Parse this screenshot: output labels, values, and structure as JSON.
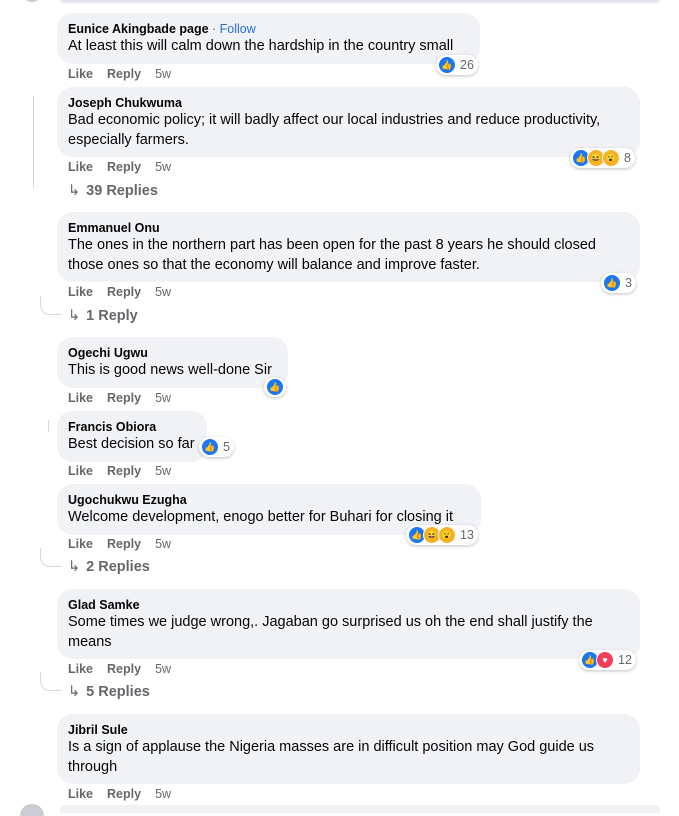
{
  "comments": [
    {
      "author": "Eunice Akingbade page",
      "follow": "Follow",
      "text": "At least this will calm down the hardship in the country small",
      "actions": {
        "like": "Like",
        "reply": "Reply",
        "time": "5w"
      },
      "reactions": {
        "types": [
          "like"
        ],
        "count": "26"
      }
    },
    {
      "author": "Joseph Chukwuma",
      "text": "Bad economic policy; it will badly affect our local industries and reduce productivity, especially farmers.",
      "actions": {
        "like": "Like",
        "reply": "Reply",
        "time": "5w"
      },
      "reactions": {
        "types": [
          "like",
          "haha",
          "wow"
        ],
        "count": "8"
      },
      "replies": "39 Replies"
    },
    {
      "author": "Emmanuel Onu",
      "text": "The ones in the northern part has been open for the past 8 years he should closed those ones so that the economy will balance and improve faster.",
      "actions": {
        "like": "Like",
        "reply": "Reply",
        "time": "5w"
      },
      "reactions": {
        "types": [
          "like"
        ],
        "count": "3"
      },
      "replies": "1 Reply"
    },
    {
      "author": "Ogechi Ugwu",
      "text": "This is good news well-done Sir",
      "actions": {
        "like": "Like",
        "reply": "Reply",
        "time": "5w"
      },
      "reactions": {
        "types": [
          "like"
        ],
        "count": ""
      }
    },
    {
      "author": "Francis Obiora",
      "text": "Best decision so far",
      "actions": {
        "like": "Like",
        "reply": "Reply",
        "time": "5w"
      },
      "reactions": {
        "types": [
          "like"
        ],
        "count": "5"
      }
    },
    {
      "author": "Ugochukwu Ezugha",
      "text": "Welcome development, enogo better for Buhari for closing it",
      "actions": {
        "like": "Like",
        "reply": "Reply",
        "time": "5w"
      },
      "reactions": {
        "types": [
          "like",
          "haha",
          "wow"
        ],
        "count": "13"
      },
      "replies": "2 Replies"
    },
    {
      "author": "Glad Samke",
      "text": "Some times we judge wrong,. Jagaban go surprised us oh the end shall justify the means",
      "actions": {
        "like": "Like",
        "reply": "Reply",
        "time": "5w"
      },
      "reactions": {
        "types": [
          "like",
          "love"
        ],
        "count": "12"
      },
      "replies": "5 Replies"
    },
    {
      "author": "Jibril Sule",
      "text": "Is a sign of applause the Nigeria masses are in difficult position may God guide us through",
      "actions": {
        "like": "Like",
        "reply": "Reply",
        "time": "5w"
      }
    }
  ],
  "colors": {
    "bubble": "#f0f2f5",
    "like": "#1877f2",
    "secondary_text": "#65676b",
    "follow": "#216fdb"
  },
  "icons": {
    "like": "thumbs-up-icon",
    "haha": "haha-emoji-icon",
    "wow": "wow-emoji-icon",
    "love": "heart-icon",
    "reply_arrow": "reply-arrow-icon"
  }
}
